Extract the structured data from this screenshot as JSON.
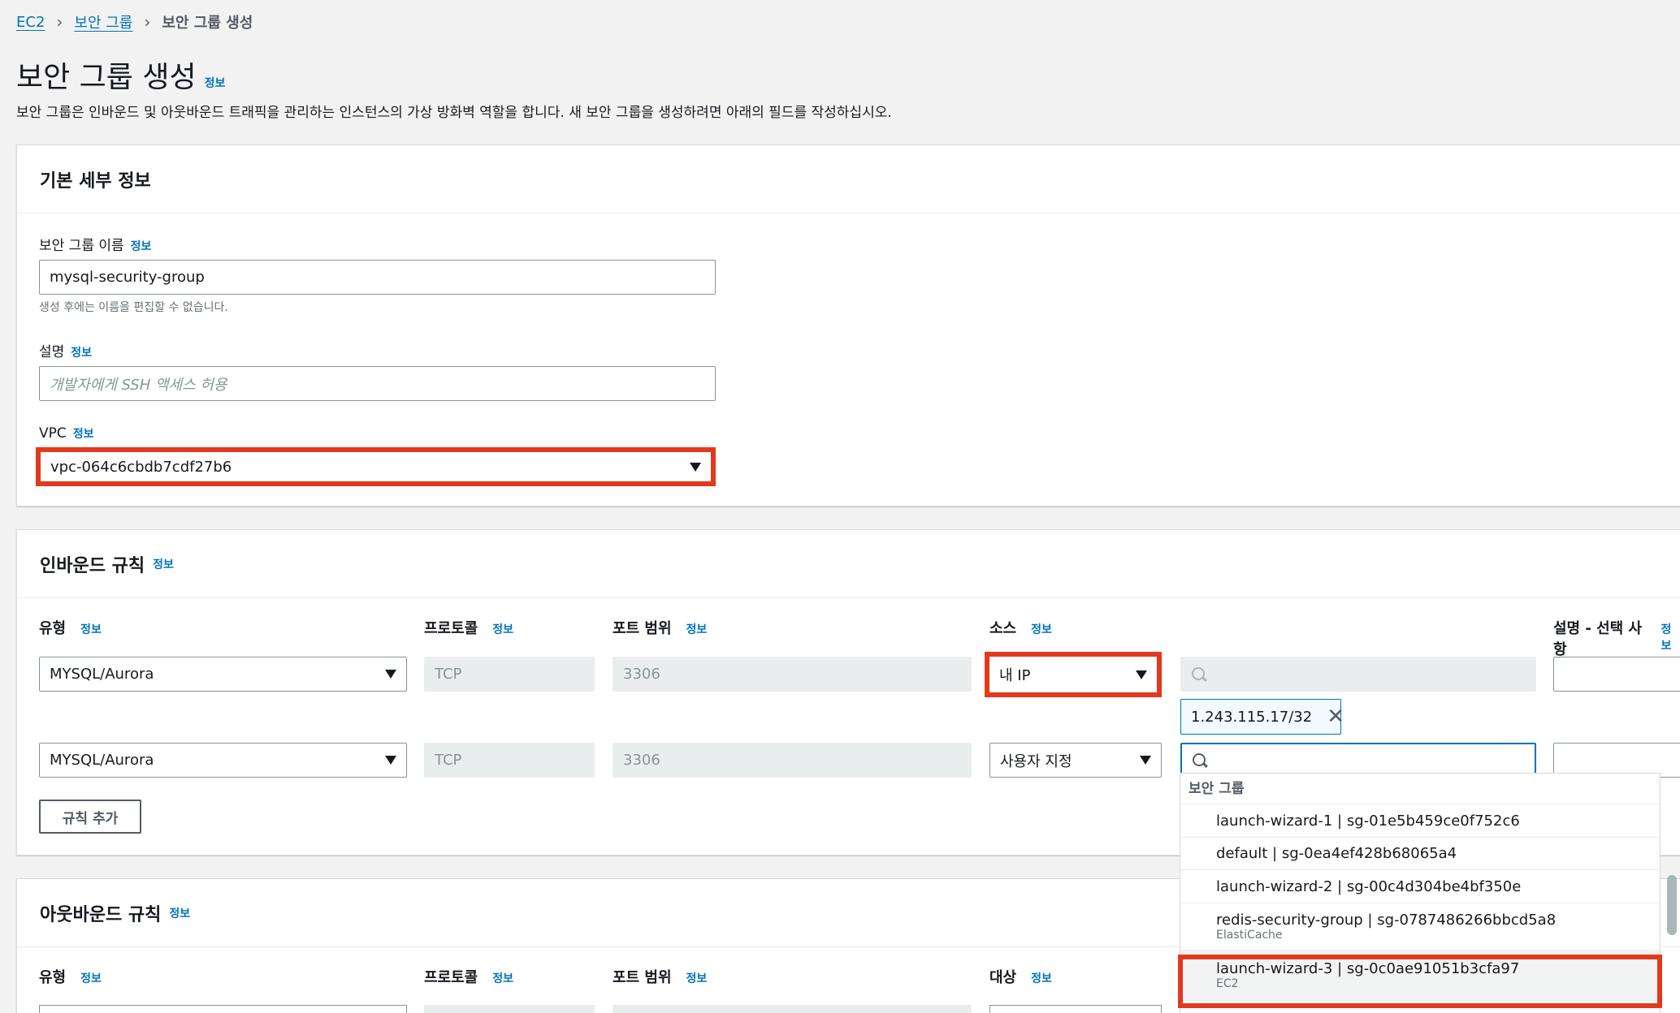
{
  "breadcrumb": {
    "ec2": "EC2",
    "security_groups": "보안 그룹",
    "current": "보안 그룹 생성"
  },
  "page": {
    "title": "보안 그룹 생성",
    "info": "정보",
    "description": "보안 그룹은 인바운드 및 아웃바운드 트래픽을 관리하는 인스턴스의 가상 방화벽 역할을 합니다. 새 보안 그룹을 생성하려면 아래의 필드를 작성하십시오."
  },
  "basic": {
    "heading": "기본 세부 정보",
    "name_label": "보안 그룹 이름",
    "name_value": "mysql-security-group",
    "name_hint": "생성 후에는 이름을 편집할 수 없습니다.",
    "desc_label": "설명",
    "desc_placeholder": "개발자에게 SSH 액세스 허용",
    "vpc_label": "VPC",
    "vpc_value": "vpc-064c6cbdb7cdf27b6"
  },
  "inbound": {
    "heading": "인바운드 규칙",
    "columns": {
      "type": "유형",
      "protocol": "프로토콜",
      "port": "포트 범위",
      "source": "소스",
      "description": "설명 - 선택 사항"
    },
    "rows": [
      {
        "type": "MYSQL/Aurora",
        "protocol": "TCP",
        "port": "3306",
        "source": "내 IP",
        "token": "1.243.115.17/32"
      },
      {
        "type": "MYSQL/Aurora",
        "protocol": "TCP",
        "port": "3306",
        "source": "사용자 지정"
      }
    ],
    "add_rule": "규칙 추가"
  },
  "outbound": {
    "heading": "아웃바운드 규칙",
    "columns": {
      "type": "유형",
      "protocol": "프로토콜",
      "port": "포트 범위",
      "dest": "대상"
    }
  },
  "dropdown": {
    "group_label": "보안 그룹",
    "items": [
      {
        "label": "launch-wizard-1 | sg-01e5b459ce0f752c6"
      },
      {
        "label": "default | sg-0ea4ef428b68065a4"
      },
      {
        "label": "launch-wizard-2 | sg-00c4d304be4bf350e"
      },
      {
        "label": "redis-security-group | sg-0787486266bbcd5a8",
        "sub": "ElastiCache"
      },
      {
        "label": "launch-wizard-3 | sg-0c0ae91051b3cfa97",
        "sub": "EC2"
      }
    ]
  },
  "info_label": "정보"
}
